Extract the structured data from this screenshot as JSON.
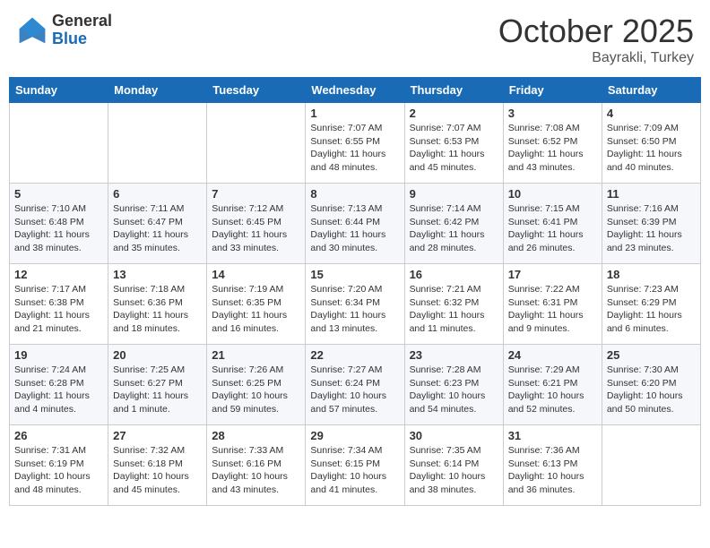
{
  "logo": {
    "general": "General",
    "blue": "Blue"
  },
  "title": "October 2025",
  "location": "Bayrakli, Turkey",
  "days_of_week": [
    "Sunday",
    "Monday",
    "Tuesday",
    "Wednesday",
    "Thursday",
    "Friday",
    "Saturday"
  ],
  "weeks": [
    [
      {
        "day": "",
        "info": ""
      },
      {
        "day": "",
        "info": ""
      },
      {
        "day": "",
        "info": ""
      },
      {
        "day": "1",
        "info": "Sunrise: 7:07 AM\nSunset: 6:55 PM\nDaylight: 11 hours and 48 minutes."
      },
      {
        "day": "2",
        "info": "Sunrise: 7:07 AM\nSunset: 6:53 PM\nDaylight: 11 hours and 45 minutes."
      },
      {
        "day": "3",
        "info": "Sunrise: 7:08 AM\nSunset: 6:52 PM\nDaylight: 11 hours and 43 minutes."
      },
      {
        "day": "4",
        "info": "Sunrise: 7:09 AM\nSunset: 6:50 PM\nDaylight: 11 hours and 40 minutes."
      }
    ],
    [
      {
        "day": "5",
        "info": "Sunrise: 7:10 AM\nSunset: 6:48 PM\nDaylight: 11 hours and 38 minutes."
      },
      {
        "day": "6",
        "info": "Sunrise: 7:11 AM\nSunset: 6:47 PM\nDaylight: 11 hours and 35 minutes."
      },
      {
        "day": "7",
        "info": "Sunrise: 7:12 AM\nSunset: 6:45 PM\nDaylight: 11 hours and 33 minutes."
      },
      {
        "day": "8",
        "info": "Sunrise: 7:13 AM\nSunset: 6:44 PM\nDaylight: 11 hours and 30 minutes."
      },
      {
        "day": "9",
        "info": "Sunrise: 7:14 AM\nSunset: 6:42 PM\nDaylight: 11 hours and 28 minutes."
      },
      {
        "day": "10",
        "info": "Sunrise: 7:15 AM\nSunset: 6:41 PM\nDaylight: 11 hours and 26 minutes."
      },
      {
        "day": "11",
        "info": "Sunrise: 7:16 AM\nSunset: 6:39 PM\nDaylight: 11 hours and 23 minutes."
      }
    ],
    [
      {
        "day": "12",
        "info": "Sunrise: 7:17 AM\nSunset: 6:38 PM\nDaylight: 11 hours and 21 minutes."
      },
      {
        "day": "13",
        "info": "Sunrise: 7:18 AM\nSunset: 6:36 PM\nDaylight: 11 hours and 18 minutes."
      },
      {
        "day": "14",
        "info": "Sunrise: 7:19 AM\nSunset: 6:35 PM\nDaylight: 11 hours and 16 minutes."
      },
      {
        "day": "15",
        "info": "Sunrise: 7:20 AM\nSunset: 6:34 PM\nDaylight: 11 hours and 13 minutes."
      },
      {
        "day": "16",
        "info": "Sunrise: 7:21 AM\nSunset: 6:32 PM\nDaylight: 11 hours and 11 minutes."
      },
      {
        "day": "17",
        "info": "Sunrise: 7:22 AM\nSunset: 6:31 PM\nDaylight: 11 hours and 9 minutes."
      },
      {
        "day": "18",
        "info": "Sunrise: 7:23 AM\nSunset: 6:29 PM\nDaylight: 11 hours and 6 minutes."
      }
    ],
    [
      {
        "day": "19",
        "info": "Sunrise: 7:24 AM\nSunset: 6:28 PM\nDaylight: 11 hours and 4 minutes."
      },
      {
        "day": "20",
        "info": "Sunrise: 7:25 AM\nSunset: 6:27 PM\nDaylight: 11 hours and 1 minute."
      },
      {
        "day": "21",
        "info": "Sunrise: 7:26 AM\nSunset: 6:25 PM\nDaylight: 10 hours and 59 minutes."
      },
      {
        "day": "22",
        "info": "Sunrise: 7:27 AM\nSunset: 6:24 PM\nDaylight: 10 hours and 57 minutes."
      },
      {
        "day": "23",
        "info": "Sunrise: 7:28 AM\nSunset: 6:23 PM\nDaylight: 10 hours and 54 minutes."
      },
      {
        "day": "24",
        "info": "Sunrise: 7:29 AM\nSunset: 6:21 PM\nDaylight: 10 hours and 52 minutes."
      },
      {
        "day": "25",
        "info": "Sunrise: 7:30 AM\nSunset: 6:20 PM\nDaylight: 10 hours and 50 minutes."
      }
    ],
    [
      {
        "day": "26",
        "info": "Sunrise: 7:31 AM\nSunset: 6:19 PM\nDaylight: 10 hours and 48 minutes."
      },
      {
        "day": "27",
        "info": "Sunrise: 7:32 AM\nSunset: 6:18 PM\nDaylight: 10 hours and 45 minutes."
      },
      {
        "day": "28",
        "info": "Sunrise: 7:33 AM\nSunset: 6:16 PM\nDaylight: 10 hours and 43 minutes."
      },
      {
        "day": "29",
        "info": "Sunrise: 7:34 AM\nSunset: 6:15 PM\nDaylight: 10 hours and 41 minutes."
      },
      {
        "day": "30",
        "info": "Sunrise: 7:35 AM\nSunset: 6:14 PM\nDaylight: 10 hours and 38 minutes."
      },
      {
        "day": "31",
        "info": "Sunrise: 7:36 AM\nSunset: 6:13 PM\nDaylight: 10 hours and 36 minutes."
      },
      {
        "day": "",
        "info": ""
      }
    ]
  ]
}
